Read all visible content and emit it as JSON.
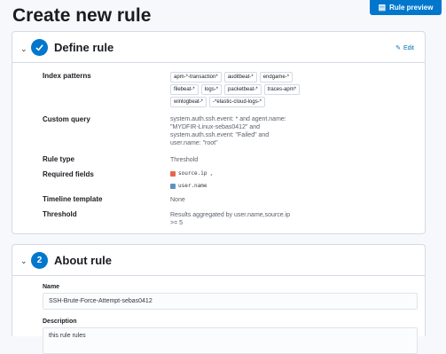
{
  "page": {
    "title": "Create new rule"
  },
  "toolbar": {
    "rule_preview_label": "Rule preview"
  },
  "step1": {
    "title": "Define rule",
    "edit_label": "Edit",
    "fields": {
      "index_patterns_label": "Index patterns",
      "index_patterns": [
        "apm-*-transaction*",
        "auditbeat-*",
        "endgame-*",
        "filebeat-*",
        "logs-*",
        "packetbeat-*",
        "traces-apm*",
        "winlogbeat-*",
        "-*elastic-cloud-logs-*"
      ],
      "custom_query_label": "Custom query",
      "custom_query_lines": [
        "system.auth.ssh.event: * and agent.name:",
        "\"MYDFIR-Linux-sebas0412\" and",
        "system.auth.ssh.event: \"Failed\" and",
        "user.name: \"root\""
      ],
      "rule_type_label": "Rule type",
      "rule_type": "Threshold",
      "required_fields_label": "Required fields",
      "required_fields": [
        "source.ip",
        "user.name"
      ],
      "required_fields_sep": ",",
      "timeline_template_label": "Timeline template",
      "timeline_template": "None",
      "threshold_label": "Threshold",
      "threshold_lines": [
        "Results aggregated by user.name,source.ip",
        ">= 5"
      ]
    }
  },
  "step2": {
    "number": "2",
    "title": "About rule",
    "name_label": "Name",
    "name_value": "SSH-Brute-Force-Attempt-sebas0412",
    "description_label": "Description",
    "description_value": "this rule rules"
  },
  "icons": {
    "step1_status": "check-icon",
    "edit": "pencil-icon",
    "preview": "pin-icon",
    "collapse": "chevron-down-icon"
  },
  "colors": {
    "primary": "#0077cc",
    "link": "#006bb8"
  }
}
